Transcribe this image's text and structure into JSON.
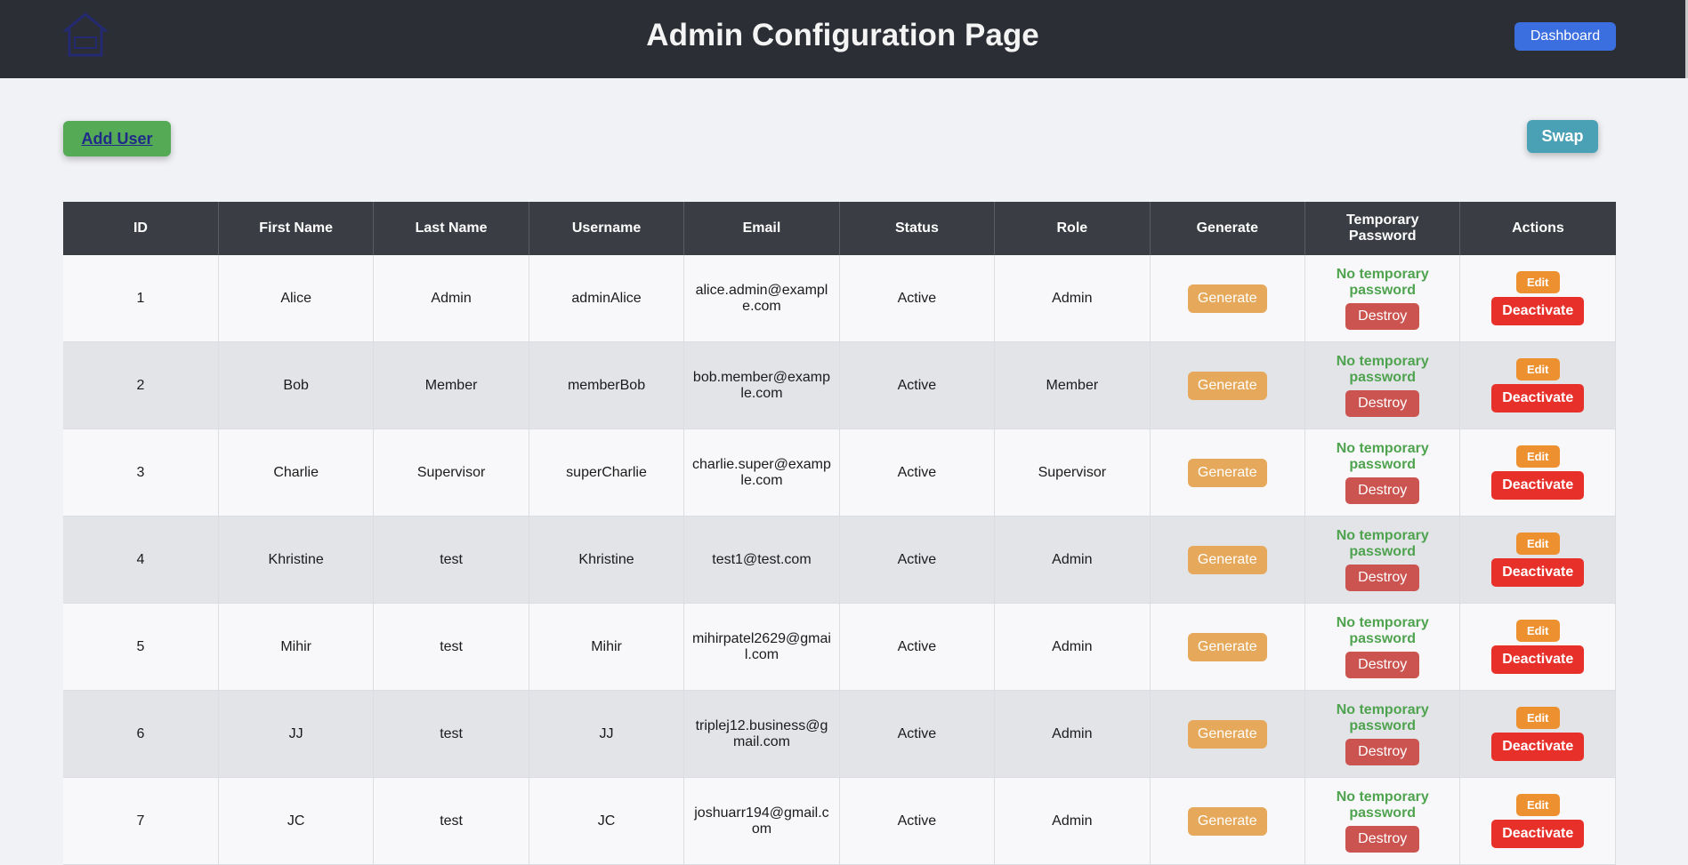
{
  "header": {
    "title": "Admin Configuration Page",
    "dashboard_label": "Dashboard",
    "logo_icon": "house-logo-icon"
  },
  "toolbar": {
    "add_user_label": "Add User",
    "swap_label": "Swap"
  },
  "table": {
    "columns": [
      "ID",
      "First Name",
      "Last Name",
      "Username",
      "Email",
      "Status",
      "Role",
      "Generate",
      "Temporary Password",
      "Actions"
    ],
    "generate_label": "Generate",
    "no_temp_label": "No temporary password",
    "destroy_label": "Destroy",
    "edit_label": "Edit",
    "deactivate_label": "Deactivate",
    "rows": [
      {
        "id": "1",
        "first": "Alice",
        "last": "Admin",
        "username": "adminAlice",
        "email": "alice.admin@example.com",
        "status": "Active",
        "role": "Admin"
      },
      {
        "id": "2",
        "first": "Bob",
        "last": "Member",
        "username": "memberBob",
        "email": "bob.member@example.com",
        "status": "Active",
        "role": "Member"
      },
      {
        "id": "3",
        "first": "Charlie",
        "last": "Supervisor",
        "username": "superCharlie",
        "email": "charlie.super@example.com",
        "status": "Active",
        "role": "Supervisor"
      },
      {
        "id": "4",
        "first": "Khristine",
        "last": "test",
        "username": "Khristine",
        "email": "test1@test.com",
        "status": "Active",
        "role": "Admin"
      },
      {
        "id": "5",
        "first": "Mihir",
        "last": "test",
        "username": "Mihir",
        "email": "mihirpatel2629@gmail.com",
        "status": "Active",
        "role": "Admin"
      },
      {
        "id": "6",
        "first": "JJ",
        "last": "test",
        "username": "JJ",
        "email": "triplej12.business@gmail.com",
        "status": "Active",
        "role": "Admin"
      },
      {
        "id": "7",
        "first": "JC",
        "last": "test",
        "username": "JC",
        "email": "joshuarr194@gmail.com",
        "status": "Active",
        "role": "Admin"
      }
    ]
  },
  "colors": {
    "header_bg": "#2b2e34",
    "dashboard": "#3b6fe0",
    "add_user": "#55ab55",
    "swap": "#4aa0b5",
    "generate": "#e6a85a",
    "destroy": "#cc5450",
    "edit": "#ed9130",
    "deactivate": "#e8302a",
    "temp_text": "#4fa34f"
  }
}
